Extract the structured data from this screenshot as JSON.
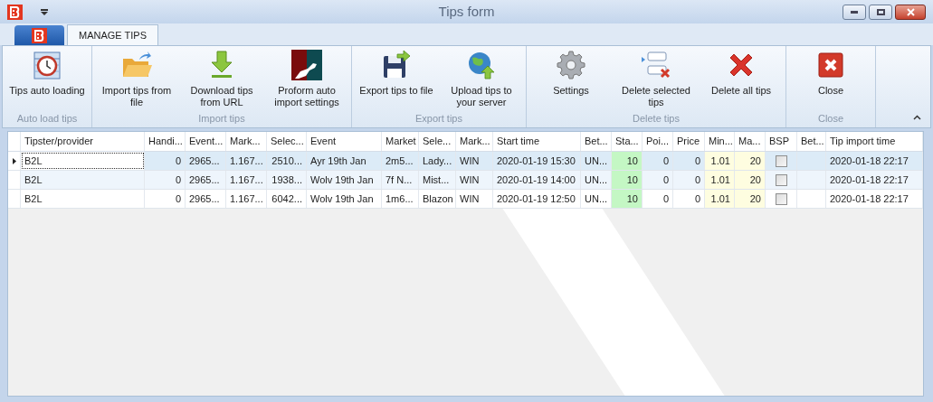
{
  "window": {
    "title": "Tips form"
  },
  "ribbon": {
    "tabs": [
      {
        "label": "MANAGE TIPS",
        "selected": true
      }
    ],
    "groups": [
      {
        "label": "Auto load tips",
        "buttons": [
          {
            "kind": "clock",
            "label": "Tips auto loading"
          }
        ]
      },
      {
        "label": "Import tips",
        "buttons": [
          {
            "kind": "folder",
            "label": "Import tips from file"
          },
          {
            "kind": "download",
            "label": "Download tips from URL"
          },
          {
            "kind": "horse",
            "label": "Proform auto import settings"
          }
        ]
      },
      {
        "label": "Export tips",
        "buttons": [
          {
            "kind": "save",
            "label": "Export tips to file"
          },
          {
            "kind": "globe",
            "label": "Upload tips to your server"
          }
        ]
      },
      {
        "label": "Delete tips",
        "buttons": [
          {
            "kind": "gear",
            "label": "Settings"
          },
          {
            "kind": "delete-selected",
            "label": "Delete selected tips"
          },
          {
            "kind": "cross",
            "label": "Delete all tips"
          }
        ]
      },
      {
        "label": "Close",
        "buttons": [
          {
            "kind": "close",
            "label": "Close"
          }
        ]
      }
    ]
  },
  "table": {
    "columns": [
      {
        "label": "Tipster/provider",
        "kind": "text"
      },
      {
        "label": "Handi...",
        "kind": "number"
      },
      {
        "label": "Event...",
        "kind": "text"
      },
      {
        "label": "Mark...",
        "kind": "text"
      },
      {
        "label": "Selec...",
        "kind": "number"
      },
      {
        "label": "Event",
        "kind": "text"
      },
      {
        "label": "Market",
        "kind": "text"
      },
      {
        "label": "Sele...",
        "kind": "text"
      },
      {
        "label": "Mark...",
        "kind": "text"
      },
      {
        "label": "Start time",
        "kind": "text"
      },
      {
        "label": "Bet...",
        "kind": "text"
      },
      {
        "label": "Sta...",
        "kind": "number",
        "color": "#c4f7c4"
      },
      {
        "label": "Poi...",
        "kind": "number"
      },
      {
        "label": "Price",
        "kind": "number"
      },
      {
        "label": "Min...",
        "kind": "number",
        "color": "#fefde0"
      },
      {
        "label": "Ma...",
        "kind": "number",
        "color": "#fefde0"
      },
      {
        "label": "BSP",
        "kind": "check"
      },
      {
        "label": "Bet...",
        "kind": "text"
      },
      {
        "label": "Tip import time",
        "kind": "text"
      }
    ],
    "rows": [
      {
        "selected": true,
        "cells": [
          "B2L",
          "0",
          "2965...",
          "1.167...",
          "2510...",
          "Ayr  19th Jan",
          "2m5...",
          "Lady...",
          "WIN",
          "2020-01-19 15:30",
          "UN...",
          "10",
          "0",
          "0",
          "1.01",
          "20",
          false,
          "",
          "2020-01-18 22:17"
        ]
      },
      {
        "selected": false,
        "cells": [
          "B2L",
          "0",
          "2965...",
          "1.167...",
          "1938...",
          "Wolv  19th Jan",
          "7f N...",
          "Mist...",
          "WIN",
          "2020-01-19 14:00",
          "UN...",
          "10",
          "0",
          "0",
          "1.01",
          "20",
          false,
          "",
          "2020-01-18 22:17"
        ]
      },
      {
        "selected": false,
        "cells": [
          "B2L",
          "0",
          "2965...",
          "1.167...",
          "6042...",
          "Wolv  19th Jan",
          "1m6...",
          "Blazon",
          "WIN",
          "2020-01-19 12:50",
          "UN...",
          "10",
          "0",
          "0",
          "1.01",
          "20",
          false,
          "",
          "2020-01-18 22:17"
        ]
      }
    ]
  }
}
